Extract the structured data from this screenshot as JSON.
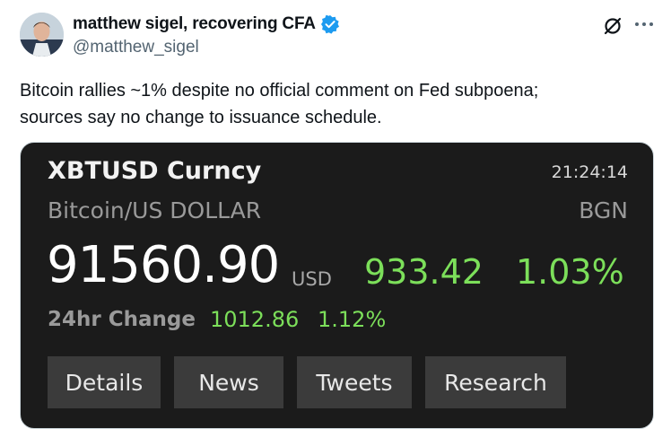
{
  "author": {
    "name": "matthew sigel, recovering CFA",
    "handle": "@matthew_sigel",
    "verified_color": "#1d9bf0"
  },
  "icons": [
    "grok-icon",
    "more-icon",
    "verified-badge-icon"
  ],
  "tweet": {
    "lines": [
      "Bitcoin rallies ~1% despite no official comment on Fed subpoena;",
      "sources say no change to issuance schedule."
    ]
  },
  "terminal": {
    "ticker": "XBTUSD Curncy",
    "time": "21:24:14",
    "description": "Bitcoin/US DOLLAR",
    "source": "BGN",
    "price": "91560.90",
    "currency": "USD",
    "change": "933.42",
    "change_pct": "1.03%",
    "change24_label": "24hr Change",
    "change24": "1012.86",
    "change24_pct": "1.12%",
    "buttons": [
      "Details",
      "News",
      "Tweets",
      "Research"
    ],
    "colors": {
      "positive": "#7cdf5a",
      "background": "#1b1b1b",
      "button": "#3b3b3b"
    }
  }
}
